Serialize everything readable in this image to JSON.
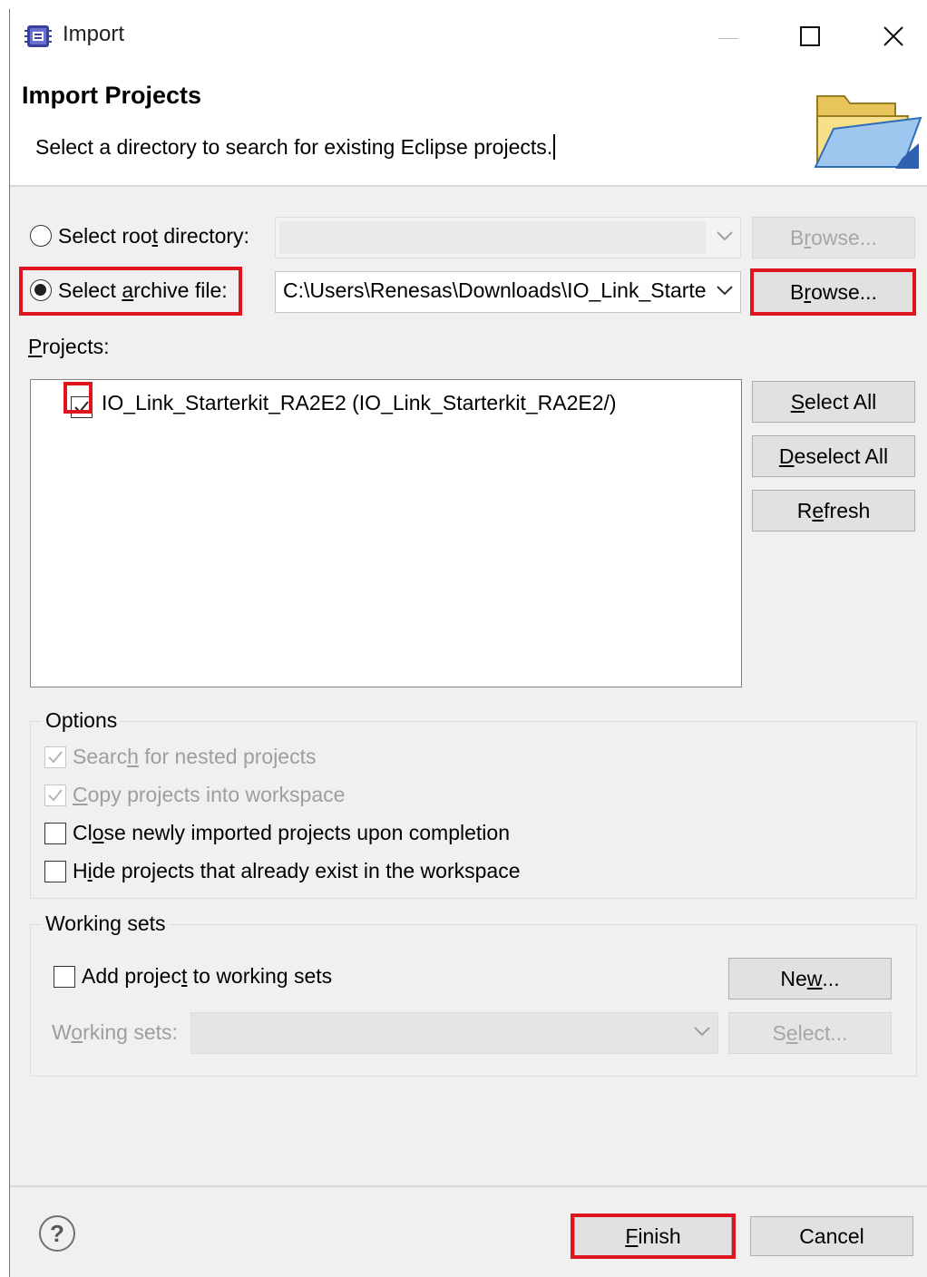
{
  "window": {
    "title": "Import"
  },
  "header": {
    "title": "Import Projects",
    "description": "Select a directory to search for existing Eclipse projects."
  },
  "source": {
    "root_dir_label_pre": "Select roo",
    "root_dir_label_u": "t",
    "root_dir_label_post": " directory:",
    "root_dir_value": "",
    "browse_root_label_pre": "B",
    "browse_root_label_u": "r",
    "browse_root_label_post": "owse...",
    "archive_label_pre": "Select ",
    "archive_label_u": "a",
    "archive_label_post": "rchive file:",
    "archive_value": "C:\\Users\\Renesas\\Downloads\\IO_Link_Starte",
    "browse_archive_label_pre": "B",
    "browse_archive_label_u": "r",
    "browse_archive_label_post": "owse...",
    "selected": "archive"
  },
  "projects": {
    "label_u": "P",
    "label_post": "rojects:",
    "items": [
      {
        "label": "IO_Link_Starterkit_RA2E2 (IO_Link_Starterkit_RA2E2/)",
        "checked": true
      }
    ],
    "select_all_u": "S",
    "select_all_post": "elect All",
    "deselect_all_u": "D",
    "deselect_all_post": "eselect All",
    "refresh_pre": "R",
    "refresh_u": "e",
    "refresh_post": "fresh"
  },
  "options": {
    "legend": "Options",
    "nested_pre": "Searc",
    "nested_u": "h",
    "nested_post": " for nested projects",
    "nested_checked": true,
    "copy_u": "C",
    "copy_post": "opy projects into workspace",
    "copy_checked": true,
    "close_pre": "Cl",
    "close_u": "o",
    "close_post": "se newly imported projects upon completion",
    "close_checked": false,
    "hide_pre": "H",
    "hide_u": "i",
    "hide_post": "de projects that already exist in the workspace",
    "hide_checked": false
  },
  "working_sets": {
    "legend": "Working sets",
    "add_pre": "Add projec",
    "add_u": "t",
    "add_post": " to working sets",
    "add_checked": false,
    "new_pre": "Ne",
    "new_u": "w",
    "new_post": "...",
    "sets_pre": "W",
    "sets_u": "o",
    "sets_post": "rking sets:",
    "sets_value": "",
    "select_pre": "S",
    "select_u": "e",
    "select_post": "lect..."
  },
  "footer": {
    "help_glyph": "?",
    "finish_u": "F",
    "finish_post": "inish",
    "cancel": "Cancel"
  },
  "colors": {
    "highlight": "#e0141e",
    "background": "#f0f0f0"
  }
}
